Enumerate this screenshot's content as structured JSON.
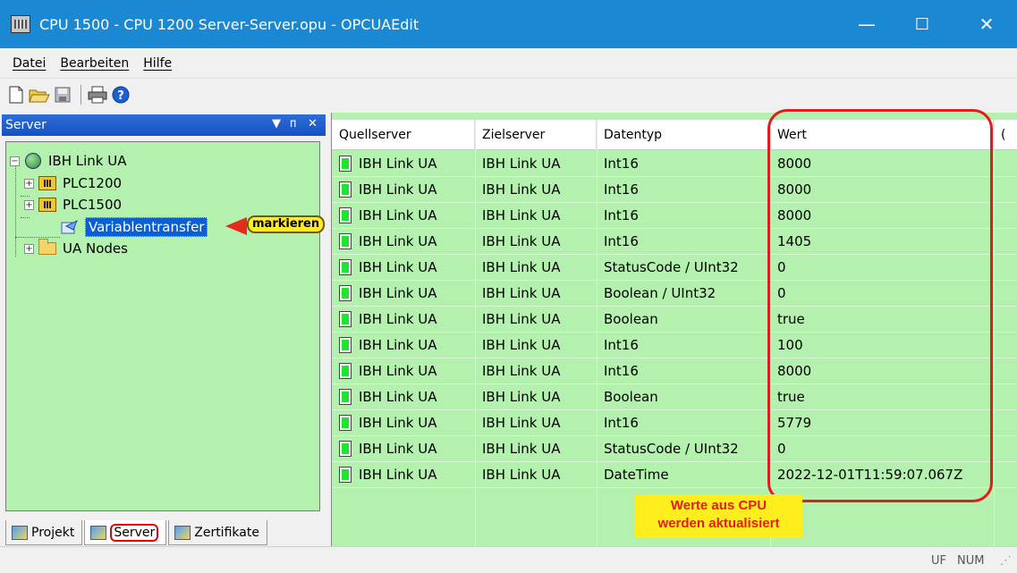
{
  "window": {
    "title": "CPU 1500 - CPU 1200 Server-Server.opu - OPCUAEdit",
    "minimize": "—",
    "maximize": "☐",
    "close": "✕"
  },
  "menu": [
    {
      "label": "Datei"
    },
    {
      "label": "Bearbeiten"
    },
    {
      "label": "Hilfe"
    }
  ],
  "toolbar": {
    "icons": [
      "new-icon",
      "open-icon",
      "save-icon",
      "print-icon",
      "help-icon"
    ]
  },
  "left_pane": {
    "title": "Server",
    "controls": {
      "dropdown": "▼",
      "pin": "ᴨ",
      "close": "✕"
    },
    "tree": [
      {
        "label": "IBH Link UA",
        "icon": "globe-icon",
        "expander": "−"
      },
      {
        "label": "PLC1200",
        "icon": "plc-icon",
        "expander": "+"
      },
      {
        "label": "PLC1500",
        "icon": "plc-icon",
        "expander": "+"
      },
      {
        "label": "Variablentransfer",
        "icon": "transfer-icon",
        "selected": true
      },
      {
        "label": "UA Nodes",
        "icon": "folder-icon",
        "expander": "+"
      }
    ],
    "callout": "markieren",
    "tabs": [
      {
        "label": "Projekt"
      },
      {
        "label": "Server"
      },
      {
        "label": "Zertifikate"
      }
    ]
  },
  "grid": {
    "columns": [
      "Quellserver",
      "Zielserver",
      "Datentyp",
      "Wert"
    ],
    "rows": [
      {
        "quell": "IBH Link UA",
        "ziel": "IBH Link UA",
        "typ": "Int16",
        "wert": "8000"
      },
      {
        "quell": "IBH Link UA",
        "ziel": "IBH Link UA",
        "typ": "Int16",
        "wert": "8000"
      },
      {
        "quell": "IBH Link UA",
        "ziel": "IBH Link UA",
        "typ": "Int16",
        "wert": "8000"
      },
      {
        "quell": "IBH Link UA",
        "ziel": "IBH Link UA",
        "typ": "Int16",
        "wert": "1405"
      },
      {
        "quell": "IBH Link UA",
        "ziel": "IBH Link UA",
        "typ": "StatusCode / UInt32",
        "wert": "0"
      },
      {
        "quell": "IBH Link UA",
        "ziel": "IBH Link UA",
        "typ": "Boolean / UInt32",
        "wert": "0"
      },
      {
        "quell": "IBH Link UA",
        "ziel": "IBH Link UA",
        "typ": "Boolean",
        "wert": "true"
      },
      {
        "quell": "IBH Link UA",
        "ziel": "IBH Link UA",
        "typ": "Int16",
        "wert": "100"
      },
      {
        "quell": "IBH Link UA",
        "ziel": "IBH Link UA",
        "typ": "Int16",
        "wert": "8000"
      },
      {
        "quell": "IBH Link UA",
        "ziel": "IBH Link UA",
        "typ": "Boolean",
        "wert": "true"
      },
      {
        "quell": "IBH Link UA",
        "ziel": "IBH Link UA",
        "typ": "Int16",
        "wert": "5779"
      },
      {
        "quell": "IBH Link UA",
        "ziel": "IBH Link UA",
        "typ": "StatusCode / UInt32",
        "wert": "0"
      },
      {
        "quell": "IBH Link UA",
        "ziel": "IBH Link UA",
        "typ": "DateTime",
        "wert": "2022-12-01T11:59:07.067Z"
      }
    ],
    "note_line1": "Werte aus CPU",
    "note_line2": "werden aktualisiert"
  },
  "statusbar": {
    "uf": "UF",
    "num": "NUM"
  },
  "colors": {
    "titlebar": "#1a88d2",
    "pane_bg": "#b4f0ae",
    "highlight_red": "#e31b1b",
    "note_yellow": "#ffee1e"
  }
}
